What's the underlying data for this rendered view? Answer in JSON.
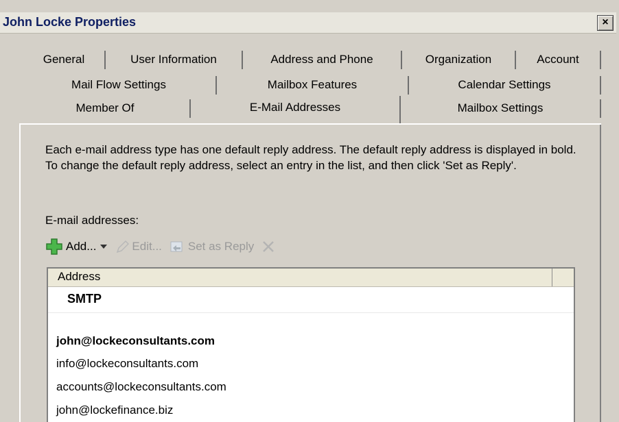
{
  "window": {
    "title": "John Locke Properties",
    "close_label": "×"
  },
  "tabs_row1": [
    "General",
    "User Information",
    "Address and Phone",
    "Organization",
    "Account"
  ],
  "tabs_row2": [
    "Mail Flow Settings",
    "Mailbox Features",
    "Calendar Settings"
  ],
  "tabs_row3": [
    "Member Of",
    "E-Mail Addresses",
    "Mailbox Settings"
  ],
  "selected_tab": "E-Mail Addresses",
  "description": "Each e-mail address type has one default reply address. The default reply address is displayed in bold. To change the default reply address, select an entry in the list, and then click 'Set as Reply'.",
  "list_label": "E-mail addresses:",
  "toolbar": {
    "add_label": "Add...",
    "edit_label": "Edit...",
    "set_reply_label": "Set as Reply"
  },
  "list": {
    "column_header": "Address",
    "group": "SMTP",
    "addresses": [
      "john@lockeconsultants.com",
      "info@lockeconsultants.com",
      "accounts@lockeconsultants.com",
      "john@lockefinance.biz"
    ],
    "default_address": "john@lockeconsultants.com"
  },
  "icons": {
    "add": "add-plus-icon",
    "edit": "pencil-icon",
    "set_reply": "set-reply-icon",
    "remove": "remove-x-icon",
    "dropdown": "dropdown-arrow-icon"
  }
}
